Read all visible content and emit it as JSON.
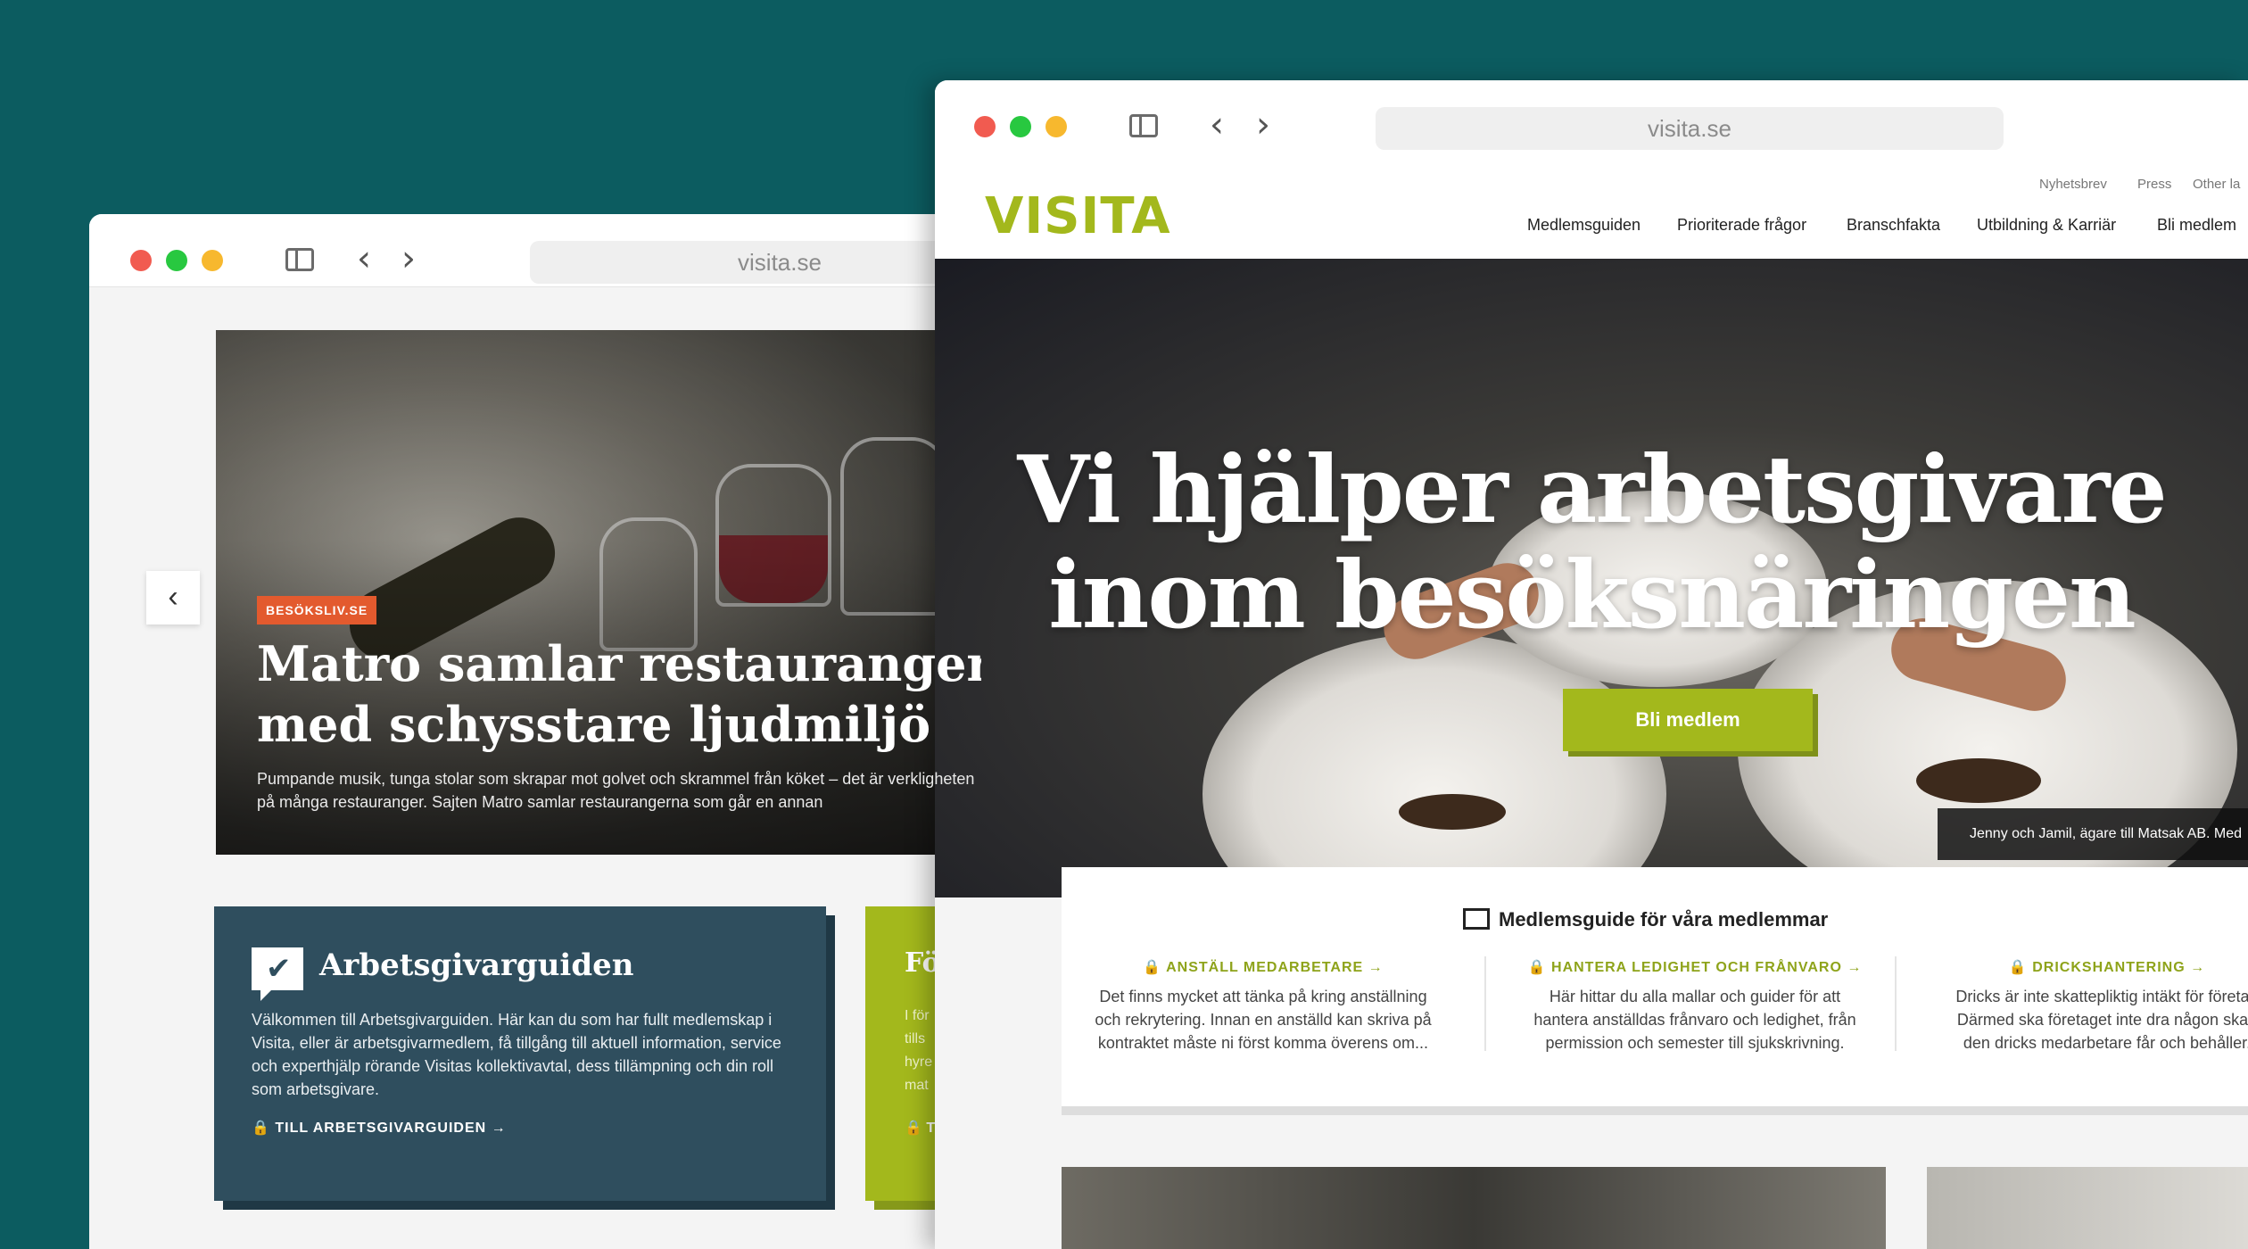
{
  "colors": {
    "background": "#0c5c60",
    "brand_green": "#a3b81c",
    "card_dark": "#2f4e5e",
    "tag_orange": "#e35a2e"
  },
  "back_window": {
    "url": "visita.se",
    "hero": {
      "tag": "BESÖKSLIV.SE",
      "title_line1": "Matro samlar restauranger",
      "title_line2": "med schysstare ljudmiljö",
      "text": "Pumpande musik, tunga stolar som skrapar mot golvet och skrammel från köket – det är verkligheten på många restauranger. Sajten Matro samlar restaurangerna som går en annan"
    },
    "card": {
      "icon": "chat-check-icon",
      "title": "Arbetsgivarguiden",
      "text": "Välkommen till Arbetsgivarguiden. Här kan du som har fullt medlemskap i Visita, eller är arbetsgivarmedlem, få tillgång till aktuell information, service och experthjälp rörande Visitas kollektivavtal, dess tillämpning och din roll som arbetsgivare.",
      "link": "🔒 TILL ARBETSGIVARGUIDEN →"
    },
    "card_green": {
      "title": "Fö",
      "lines": [
        "I för",
        "tills",
        "hyre",
        "mat"
      ],
      "link": "🔒 T"
    }
  },
  "front_window": {
    "url": "visita.se",
    "logo": "VISITA",
    "top_links": [
      "Nyhetsbrev",
      "Press",
      "Other la"
    ],
    "nav": [
      "Medlemsguiden",
      "Prioriterade frågor",
      "Branschfakta",
      "Utbildning & Karriär",
      "Bli medlem"
    ],
    "hero": {
      "title_line1": "Vi hjälper arbetsgivare",
      "title_line2": "inom besöksnäringen",
      "cta": "Bli medlem",
      "caption": "Jenny och Jamil, ägare till Matsak AB. Med"
    },
    "guide": {
      "title": "Medlemsguide för våra medlemmar",
      "columns": [
        {
          "heading": "🔒 ANSTÄLL MEDARBETARE →",
          "lines": [
            "Det finns mycket att tänka på kring anställning",
            "och rekrytering. Innan en anställd kan skriva på",
            "kontraktet måste ni först komma överens om..."
          ]
        },
        {
          "heading": "🔒 HANTERA LEDIGHET OCH FRÅNVARO →",
          "lines": [
            "Här hittar du alla mallar och guider för att",
            "hantera anställdas frånvaro och ledighet, från",
            "permission och semester till sjukskrivning."
          ]
        },
        {
          "heading": "🔒 DRICKSHANTERING →",
          "lines": [
            "Dricks är inte skattepliktig intäkt för företag",
            "Därmed ska företaget inte dra någon skatt",
            "den dricks medarbetare får och behåller."
          ]
        }
      ]
    }
  }
}
